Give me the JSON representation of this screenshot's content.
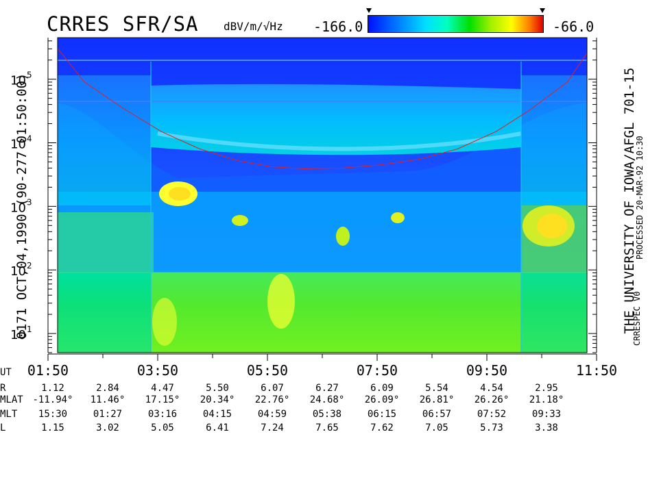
{
  "header": {
    "title": "CRRES SFR/SA",
    "unit": "dBV/m/√Hz",
    "colorbar_min": "-166.0",
    "colorbar_max": "-66.0"
  },
  "left_label": "0171  OCT,04,1990  (90-277 01:50:00)",
  "right_label_main": "THE UNIVERSITY OF IOWA/AFGL 701-15",
  "right_label_processed": "PROCESSED 20-MAR-92  10:30",
  "right_label_version": "CRRESPEC V0",
  "colors": {
    "background_noise": "#1a4cff",
    "band_cyan": "#00d8ff",
    "low_green": "#20e060",
    "hot_yellow": "#ffff30",
    "cutoff_line": "#e02020"
  },
  "chart_data": {
    "type": "heatmap",
    "xlabel": "UT",
    "x_ticks": [
      "01:50",
      "03:50",
      "05:50",
      "07:50",
      "09:50",
      "11:50"
    ],
    "x_range_hours": [
      1.8333,
      11.8333
    ],
    "y_scale": "log",
    "y_range": [
      5,
      450000
    ],
    "y_ticks": [
      {
        "label": "10",
        "exp": "1",
        "value": 10
      },
      {
        "label": "10",
        "exp": "2",
        "value": 100
      },
      {
        "label": "10",
        "exp": "3",
        "value": 1000
      },
      {
        "label": "10",
        "exp": "4",
        "value": 10000
      },
      {
        "label": "10",
        "exp": "5",
        "value": 100000
      }
    ],
    "colorbar": {
      "min": -166.0,
      "max": -66.0,
      "unit": "dBV/m/√Hz"
    },
    "cutoff_curve": {
      "x": [
        1.85,
        2.5,
        3.2,
        3.9,
        4.6,
        5.3,
        5.9,
        6.5,
        7.2,
        7.9,
        8.6,
        9.3,
        10.0,
        10.6,
        11.3,
        11.85
      ],
      "y": [
        450000,
        90000,
        35000,
        15000,
        8000,
        5200,
        4200,
        3900,
        4000,
        4500,
        5500,
        8000,
        15000,
        32000,
        90000,
        450000
      ]
    }
  },
  "ephemeris": {
    "rows": [
      {
        "label": "UT",
        "values": []
      },
      {
        "label": "R",
        "values": [
          "1.12",
          "2.84",
          "4.47",
          "5.50",
          "6.07",
          "6.27",
          "6.09",
          "5.54",
          "4.54",
          "2.95"
        ]
      },
      {
        "label": "MLAT",
        "values": [
          "-11.94°",
          "11.46°",
          "17.15°",
          "20.34°",
          "22.76°",
          "24.68°",
          "26.09°",
          "26.81°",
          "26.26°",
          "21.18°"
        ]
      },
      {
        "label": "MLT",
        "values": [
          "15:30",
          "01:27",
          "03:16",
          "04:15",
          "04:59",
          "05:38",
          "06:15",
          "06:57",
          "07:52",
          "09:33"
        ]
      },
      {
        "label": "L",
        "values": [
          "1.15",
          "3.02",
          "5.05",
          "6.41",
          "7.24",
          "7.65",
          "7.62",
          "7.05",
          "5.73",
          "3.38"
        ]
      }
    ]
  }
}
